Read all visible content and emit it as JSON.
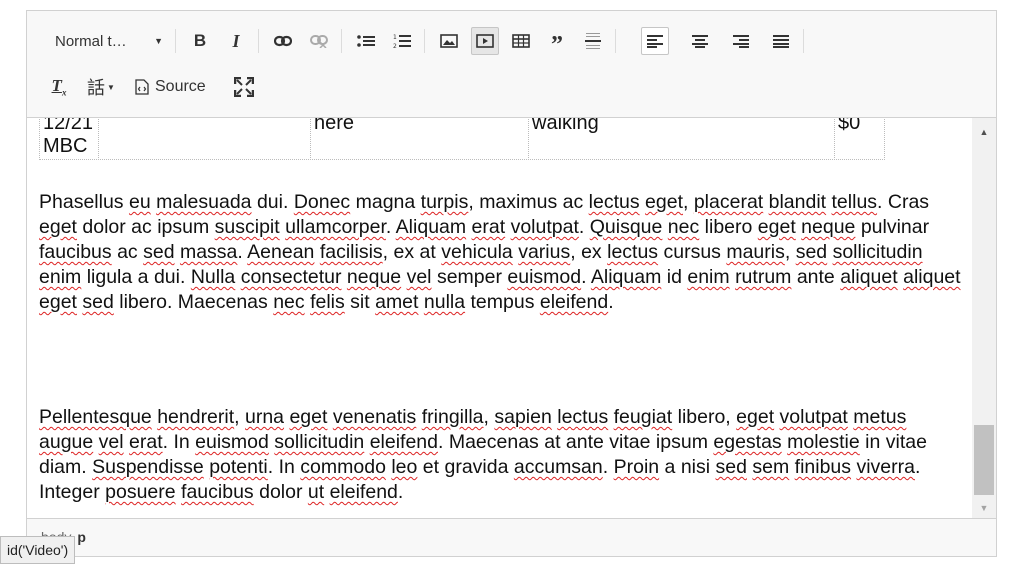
{
  "toolbar": {
    "format_select": "Normal t…",
    "bold": "B",
    "italic": "I",
    "source_label": "Source",
    "language_glyph": "話"
  },
  "table": {
    "row": [
      "12/21 MBC",
      "here",
      "walking",
      "$0"
    ]
  },
  "paragraphs": {
    "p1": "Phasellus eu malesuada dui. Donec magna turpis, maximus ac lectus eget, placerat blandit tellus. Cras eget dolor ac ipsum suscipit ullamcorper. Aliquam erat volutpat. Quisque nec libero eget neque pulvinar faucibus ac sed massa. Aenean facilisis, ex at vehicula varius, ex lectus cursus mauris, sed sollicitudin enim ligula a dui. Nulla consectetur neque vel semper euismod. Aliquam id enim rutrum ante aliquet aliquet eget sed libero. Maecenas nec felis sit amet nulla tempus eleifend.",
    "p2": "Pellentesque hendrerit, urna eget venenatis fringilla, sapien lectus feugiat libero, eget volutpat metus augue vel erat. In euismod sollicitudin eleifend. Maecenas at ante vitae ipsum egestas molestie in vitae diam. Suspendisse potenti. In commodo leo et gravida accumsan. Proin a nisi sed sem finibus viverra. Integer posuere faucibus dolor ut eleifend."
  },
  "misspelled": [
    "eu",
    "malesuada",
    "Donec",
    "turpis",
    "lectus",
    "eget",
    "placerat",
    "blandit",
    "tellus",
    "suscipit",
    "ullamcorper",
    "Aliquam",
    "erat",
    "volutpat",
    "Quisque",
    "nec",
    "neque",
    "faucibus",
    "sed",
    "massa",
    "Aenean",
    "facilisis",
    "vehicula",
    "varius",
    "mauris",
    "sollicitudin",
    "enim",
    "Nulla",
    "consectetur",
    "vel",
    "euismod",
    "rutrum",
    "aliquet",
    "felis",
    "amet",
    "nulla",
    "eleifend",
    "Pellentesque",
    "hendrerit",
    "urna",
    "venenatis",
    "fringilla",
    "sapien",
    "feugiat",
    "metus",
    "augue",
    "Suspendisse",
    "potenti",
    "commodo",
    "leo",
    "accumsan",
    "Proin",
    "sem",
    "finibus",
    "viverra",
    "posuere",
    "ut",
    "egestas",
    "molestie"
  ],
  "statusbar": {
    "path_body": "body",
    "path_p": "p"
  },
  "tooltip": "id('Video')",
  "icons": [
    "bold-icon",
    "italic-icon",
    "link-icon",
    "unlink-icon",
    "bulleted-list-icon",
    "numbered-list-icon",
    "image-icon",
    "video-icon",
    "table-icon",
    "blockquote-icon",
    "horizontal-rule-icon",
    "align-left-icon",
    "align-center-icon",
    "align-right-icon",
    "justify-icon",
    "remove-format-icon",
    "language-icon",
    "source-icon",
    "maximize-icon"
  ],
  "colors": {
    "toolbar_bg": "#f8f8f8",
    "spell_underline": "#dd2222",
    "active_button": "#e6e6e6"
  }
}
